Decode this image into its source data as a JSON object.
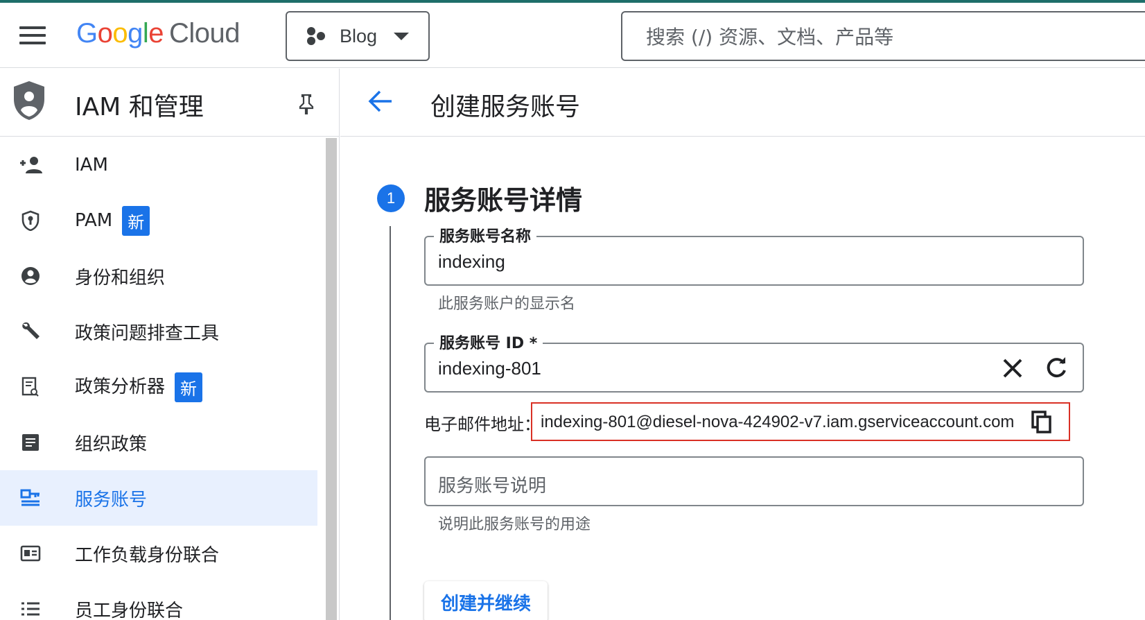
{
  "header": {
    "logo_google": "Google",
    "logo_cloud": "Cloud",
    "project_name": "Blog",
    "search_placeholder": "搜索 (/) 资源、文档、产品等"
  },
  "sidebar": {
    "title": "IAM 和管理",
    "items": [
      {
        "label": "IAM",
        "icon": "person-add-icon",
        "badge": ""
      },
      {
        "label": "PAM",
        "icon": "shield-lock-icon",
        "badge": "新"
      },
      {
        "label": "身份和组织",
        "icon": "account-circle-icon",
        "badge": ""
      },
      {
        "label": "政策问题排查工具",
        "icon": "wrench-icon",
        "badge": ""
      },
      {
        "label": "政策分析器",
        "icon": "document-search-icon",
        "badge": "新"
      },
      {
        "label": "组织政策",
        "icon": "list-alt-icon",
        "badge": ""
      },
      {
        "label": "服务账号",
        "icon": "service-account-icon",
        "badge": "",
        "active": true
      },
      {
        "label": "工作负载身份联合",
        "icon": "id-card-icon",
        "badge": ""
      },
      {
        "label": "员工身份联合",
        "icon": "list-icon",
        "badge": ""
      }
    ]
  },
  "main": {
    "title": "创建服务账号",
    "step": {
      "number": "1",
      "title": "服务账号详情"
    },
    "name_field": {
      "label": "服务账号名称",
      "value": "indexing",
      "hint": "此服务账户的显示名"
    },
    "id_field": {
      "label": "服务账号 ID *",
      "value": "indexing-801"
    },
    "email": {
      "label": "电子邮件地址：",
      "value": "indexing-801@diesel-nova-424902-v7.iam.gserviceaccount.com"
    },
    "description_field": {
      "placeholder": "服务账号说明",
      "hint": "说明此服务账号的用途"
    },
    "create_button": "创建并继续"
  },
  "colors": {
    "accent": "#1a73e8",
    "highlight_border": "#d93025",
    "active_bg": "#e8f0fe"
  }
}
